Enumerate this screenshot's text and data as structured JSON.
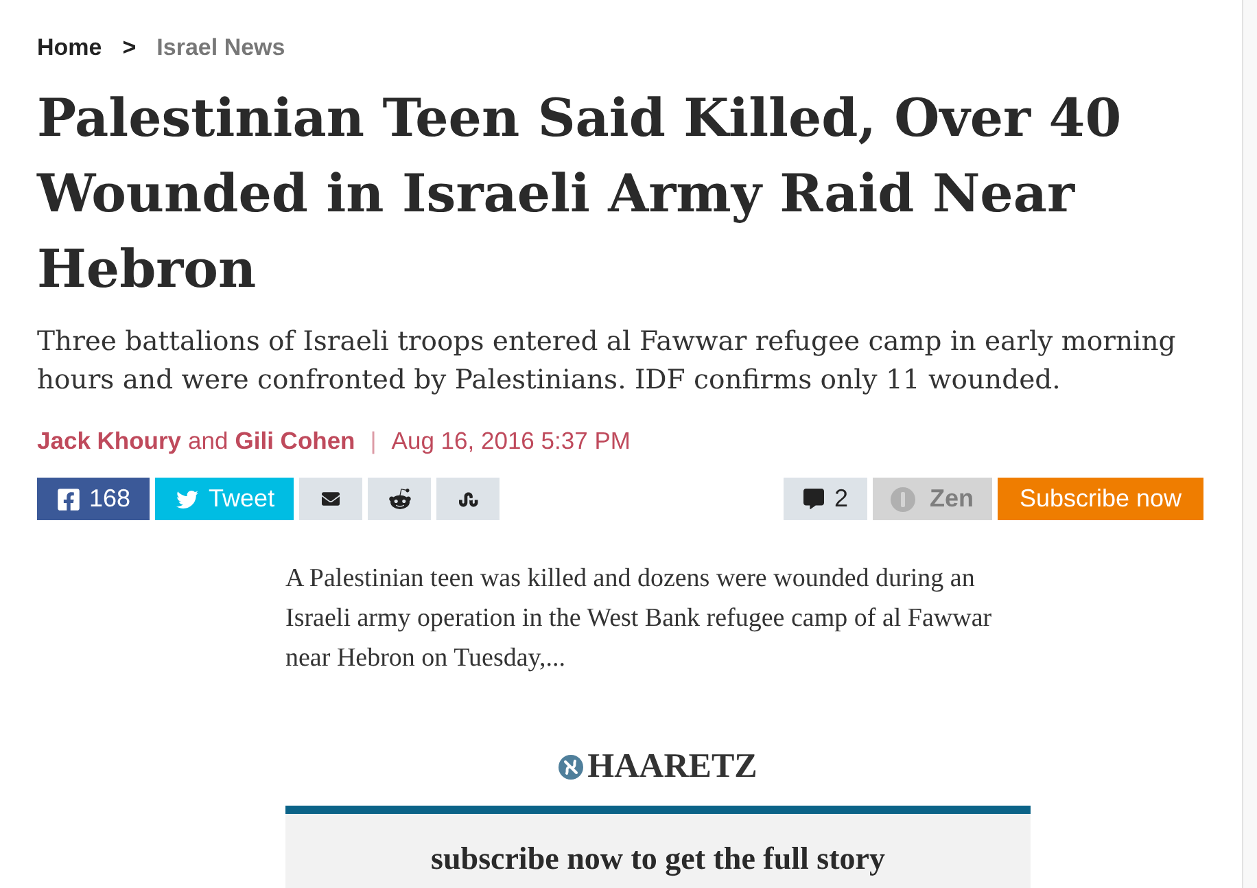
{
  "breadcrumb": {
    "items": [
      {
        "label": "Home",
        "current": false
      },
      {
        "label": "Israel News",
        "current": true
      }
    ],
    "separator": ">"
  },
  "headline": "Palestinian Teen Said Killed, Over 40 Wounded in Israeli Army Raid Near Hebron",
  "subheadline": "Three battalions of Israeli troops entered al Fawwar refugee camp in early morning hours and were confronted by Palestinians. IDF confirms only 11 wounded.",
  "byline": {
    "authors": [
      "Jack Khoury",
      "Gili Cohen"
    ],
    "conjunction": "and",
    "separator": "|",
    "date": "Aug 16, 2016 5:37 PM"
  },
  "share_buttons": [
    {
      "kind": "facebook",
      "label": "168"
    },
    {
      "kind": "twitter",
      "label": "Tweet"
    },
    {
      "kind": "email"
    },
    {
      "kind": "reddit"
    },
    {
      "kind": "stumbleupon"
    }
  ],
  "comments": {
    "count": "2"
  },
  "zen": {
    "label": "Zen",
    "on": false
  },
  "subscribe_button": "Subscribe now",
  "excerpt": "A Palestinian teen was killed and dozens were wounded during an Israeli army operation in the West Bank refugee camp of al Fawwar near Hebron on Tuesday,...",
  "paywall": {
    "logo": "HAARETZ",
    "message": "subscribe now to get the full story"
  }
}
